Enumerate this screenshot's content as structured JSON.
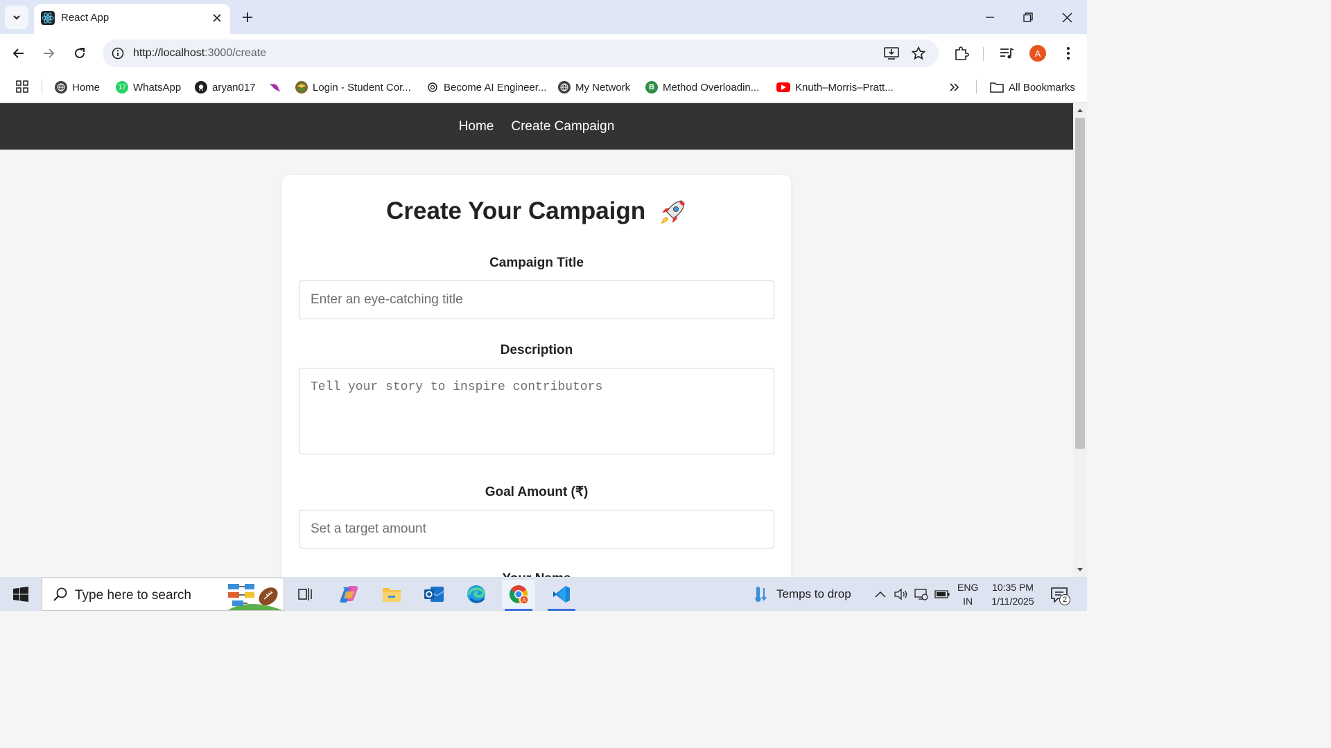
{
  "browser": {
    "tab_title": "React App",
    "url_host": "http://localhost",
    "url_rest": ":3000/create",
    "bookmarks": [
      {
        "label": "Home",
        "icon": "globe-icon"
      },
      {
        "label": "WhatsApp",
        "icon": "whatsapp-icon"
      },
      {
        "label": "aryan017",
        "icon": "github-icon"
      },
      {
        "label": "",
        "icon": "bird-icon"
      },
      {
        "label": "Login - Student Cor...",
        "icon": "student-portal-icon"
      },
      {
        "label": "Become AI Engineer...",
        "icon": "openai-icon"
      },
      {
        "label": "My Network",
        "icon": "globe-icon"
      },
      {
        "label": "Method Overloadin...",
        "icon": "b-icon"
      },
      {
        "label": "Knuth–Morris–Pratt...",
        "icon": "youtube-icon"
      }
    ],
    "all_bookmarks_label": "All Bookmarks",
    "profile_initial": "A"
  },
  "app": {
    "nav": {
      "home": "Home",
      "create": "Create Campaign"
    },
    "form": {
      "title": "Create Your Campaign",
      "title_label": "Campaign Title",
      "title_placeholder": "Enter an eye-catching title",
      "description_label": "Description",
      "description_placeholder": "Tell your story to inspire contributors",
      "goal_label": "Goal Amount (₹)",
      "goal_placeholder": "Set a target amount",
      "name_label": "Your Name"
    }
  },
  "taskbar": {
    "search_placeholder": "Type here to search",
    "weather_text": "Temps to drop",
    "lang_line1": "ENG",
    "lang_line2": "IN",
    "time": "10:35 PM",
    "date": "1/11/2025",
    "notification_count": "2"
  },
  "colors": {
    "nav_bg": "#333333",
    "page_bg": "#f5f5f5",
    "tabbar_bg": "#dfe7f7",
    "profile": "#e8541e",
    "taskbar_bg": "#dde3f0"
  }
}
